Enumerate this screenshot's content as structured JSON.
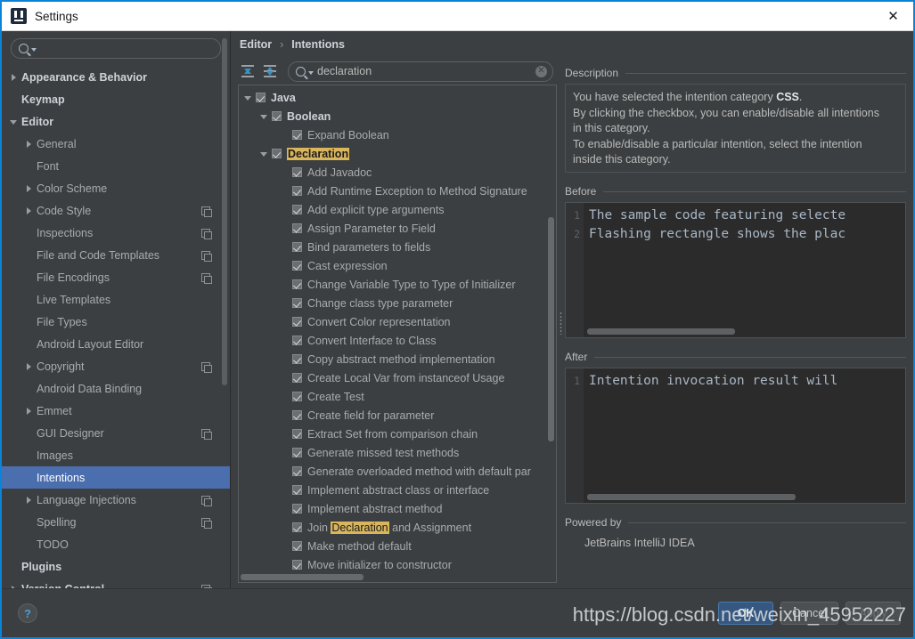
{
  "window": {
    "title": "Settings",
    "close_label": "✕",
    "logo_icon": "intellij-idea-logo"
  },
  "sidebar": {
    "search": {
      "value": "",
      "placeholder": ""
    },
    "items": [
      {
        "label": "Appearance & Behavior",
        "level": 0,
        "arrow": "right",
        "bold": true,
        "copy": false,
        "selected": false
      },
      {
        "label": "Keymap",
        "level": 0,
        "arrow": "none",
        "bold": true,
        "copy": false,
        "selected": false
      },
      {
        "label": "Editor",
        "level": 0,
        "arrow": "down",
        "bold": true,
        "copy": false,
        "selected": false
      },
      {
        "label": "General",
        "level": 1,
        "arrow": "right",
        "bold": false,
        "copy": false,
        "selected": false
      },
      {
        "label": "Font",
        "level": 1,
        "arrow": "none",
        "bold": false,
        "copy": false,
        "selected": false
      },
      {
        "label": "Color Scheme",
        "level": 1,
        "arrow": "right",
        "bold": false,
        "copy": false,
        "selected": false
      },
      {
        "label": "Code Style",
        "level": 1,
        "arrow": "right",
        "bold": false,
        "copy": true,
        "selected": false
      },
      {
        "label": "Inspections",
        "level": 1,
        "arrow": "none",
        "bold": false,
        "copy": true,
        "selected": false
      },
      {
        "label": "File and Code Templates",
        "level": 1,
        "arrow": "none",
        "bold": false,
        "copy": true,
        "selected": false
      },
      {
        "label": "File Encodings",
        "level": 1,
        "arrow": "none",
        "bold": false,
        "copy": true,
        "selected": false
      },
      {
        "label": "Live Templates",
        "level": 1,
        "arrow": "none",
        "bold": false,
        "copy": false,
        "selected": false
      },
      {
        "label": "File Types",
        "level": 1,
        "arrow": "none",
        "bold": false,
        "copy": false,
        "selected": false
      },
      {
        "label": "Android Layout Editor",
        "level": 1,
        "arrow": "none",
        "bold": false,
        "copy": false,
        "selected": false
      },
      {
        "label": "Copyright",
        "level": 1,
        "arrow": "right",
        "bold": false,
        "copy": true,
        "selected": false
      },
      {
        "label": "Android Data Binding",
        "level": 1,
        "arrow": "none",
        "bold": false,
        "copy": false,
        "selected": false
      },
      {
        "label": "Emmet",
        "level": 1,
        "arrow": "right",
        "bold": false,
        "copy": false,
        "selected": false
      },
      {
        "label": "GUI Designer",
        "level": 1,
        "arrow": "none",
        "bold": false,
        "copy": true,
        "selected": false
      },
      {
        "label": "Images",
        "level": 1,
        "arrow": "none",
        "bold": false,
        "copy": false,
        "selected": false
      },
      {
        "label": "Intentions",
        "level": 1,
        "arrow": "none",
        "bold": false,
        "copy": false,
        "selected": true
      },
      {
        "label": "Language Injections",
        "level": 1,
        "arrow": "right",
        "bold": false,
        "copy": true,
        "selected": false
      },
      {
        "label": "Spelling",
        "level": 1,
        "arrow": "none",
        "bold": false,
        "copy": true,
        "selected": false
      },
      {
        "label": "TODO",
        "level": 1,
        "arrow": "none",
        "bold": false,
        "copy": false,
        "selected": false
      },
      {
        "label": "Plugins",
        "level": 0,
        "arrow": "none",
        "bold": true,
        "copy": false,
        "selected": false
      },
      {
        "label": "Version Control",
        "level": 0,
        "arrow": "right",
        "bold": true,
        "copy": true,
        "selected": false
      }
    ]
  },
  "breadcrumb": {
    "parent": "Editor",
    "separator": "›",
    "current": "Intentions"
  },
  "toolbar": {
    "expand_all_icon": "expand-all-icon",
    "collapse_all_icon": "collapse-all-icon",
    "filter": {
      "value": "declaration",
      "placeholder": "",
      "clear_label": "✕"
    }
  },
  "intentions_tree": [
    {
      "label": "Java",
      "indent": 0,
      "arrow": "down",
      "checked": true,
      "category": true,
      "highlight": ""
    },
    {
      "label": "Boolean",
      "indent": 1,
      "arrow": "down",
      "checked": true,
      "category": true,
      "highlight": ""
    },
    {
      "label": "Expand Boolean",
      "indent": 2,
      "arrow": "none",
      "checked": true,
      "category": false,
      "highlight": ""
    },
    {
      "label": "Declaration",
      "indent": 1,
      "arrow": "down",
      "checked": true,
      "category": true,
      "highlight": "Declaration"
    },
    {
      "label": "Add Javadoc",
      "indent": 2,
      "arrow": "none",
      "checked": true,
      "category": false,
      "highlight": ""
    },
    {
      "label": "Add Runtime Exception to Method Signature",
      "indent": 2,
      "arrow": "none",
      "checked": true,
      "category": false,
      "highlight": ""
    },
    {
      "label": "Add explicit type arguments",
      "indent": 2,
      "arrow": "none",
      "checked": true,
      "category": false,
      "highlight": ""
    },
    {
      "label": "Assign Parameter to Field",
      "indent": 2,
      "arrow": "none",
      "checked": true,
      "category": false,
      "highlight": ""
    },
    {
      "label": "Bind parameters to fields",
      "indent": 2,
      "arrow": "none",
      "checked": true,
      "category": false,
      "highlight": ""
    },
    {
      "label": "Cast expression",
      "indent": 2,
      "arrow": "none",
      "checked": true,
      "category": false,
      "highlight": ""
    },
    {
      "label": "Change Variable Type to Type of Initializer",
      "indent": 2,
      "arrow": "none",
      "checked": true,
      "category": false,
      "highlight": ""
    },
    {
      "label": "Change class type parameter",
      "indent": 2,
      "arrow": "none",
      "checked": true,
      "category": false,
      "highlight": ""
    },
    {
      "label": "Convert Color representation",
      "indent": 2,
      "arrow": "none",
      "checked": true,
      "category": false,
      "highlight": ""
    },
    {
      "label": "Convert Interface to Class",
      "indent": 2,
      "arrow": "none",
      "checked": true,
      "category": false,
      "highlight": ""
    },
    {
      "label": "Copy abstract method implementation",
      "indent": 2,
      "arrow": "none",
      "checked": true,
      "category": false,
      "highlight": ""
    },
    {
      "label": "Create Local Var from instanceof Usage",
      "indent": 2,
      "arrow": "none",
      "checked": true,
      "category": false,
      "highlight": ""
    },
    {
      "label": "Create Test",
      "indent": 2,
      "arrow": "none",
      "checked": true,
      "category": false,
      "highlight": ""
    },
    {
      "label": "Create field for parameter",
      "indent": 2,
      "arrow": "none",
      "checked": true,
      "category": false,
      "highlight": ""
    },
    {
      "label": "Extract Set from comparison chain",
      "indent": 2,
      "arrow": "none",
      "checked": true,
      "category": false,
      "highlight": ""
    },
    {
      "label": "Generate missed test methods",
      "indent": 2,
      "arrow": "none",
      "checked": true,
      "category": false,
      "highlight": ""
    },
    {
      "label": "Generate overloaded method with default par",
      "indent": 2,
      "arrow": "none",
      "checked": true,
      "category": false,
      "highlight": ""
    },
    {
      "label": "Implement abstract class or interface",
      "indent": 2,
      "arrow": "none",
      "checked": true,
      "category": false,
      "highlight": ""
    },
    {
      "label": "Implement abstract method",
      "indent": 2,
      "arrow": "none",
      "checked": true,
      "category": false,
      "highlight": ""
    },
    {
      "label": "Join Declaration and Assignment",
      "indent": 2,
      "arrow": "none",
      "checked": true,
      "category": false,
      "highlight": "Declaration"
    },
    {
      "label": "Make method default",
      "indent": 2,
      "arrow": "none",
      "checked": true,
      "category": false,
      "highlight": ""
    },
    {
      "label": "Move initializer to constructor",
      "indent": 2,
      "arrow": "none",
      "checked": true,
      "category": false,
      "highlight": ""
    }
  ],
  "description": {
    "title": "Description",
    "lines": [
      {
        "pre": "You have selected the intention category ",
        "strong": "CSS",
        "post": "."
      },
      {
        "pre": "By clicking the checkbox, you can enable/disable all intentions",
        "strong": "",
        "post": ""
      },
      {
        "pre": "in this category.",
        "strong": "",
        "post": ""
      },
      {
        "pre": "To enable/disable a particular intention, select the intention",
        "strong": "",
        "post": ""
      },
      {
        "pre": "inside this category.",
        "strong": "",
        "post": ""
      }
    ]
  },
  "before": {
    "title": "Before",
    "lines": [
      {
        "no": "1",
        "text": "The sample code featuring selecte"
      },
      {
        "no": "2",
        "text": "Flashing rectangle shows the plac"
      }
    ]
  },
  "after": {
    "title": "After",
    "lines": [
      {
        "no": "1",
        "text": "Intention invocation result will"
      }
    ]
  },
  "powered_by": {
    "title": "Powered by",
    "value": "JetBrains IntelliJ IDEA"
  },
  "footer": {
    "help_label": "?",
    "ok_label": "OK",
    "cancel_label": "Cancel",
    "apply_label": "Apply"
  },
  "watermark": "https://blog.csdn.net/weixin_45952227"
}
